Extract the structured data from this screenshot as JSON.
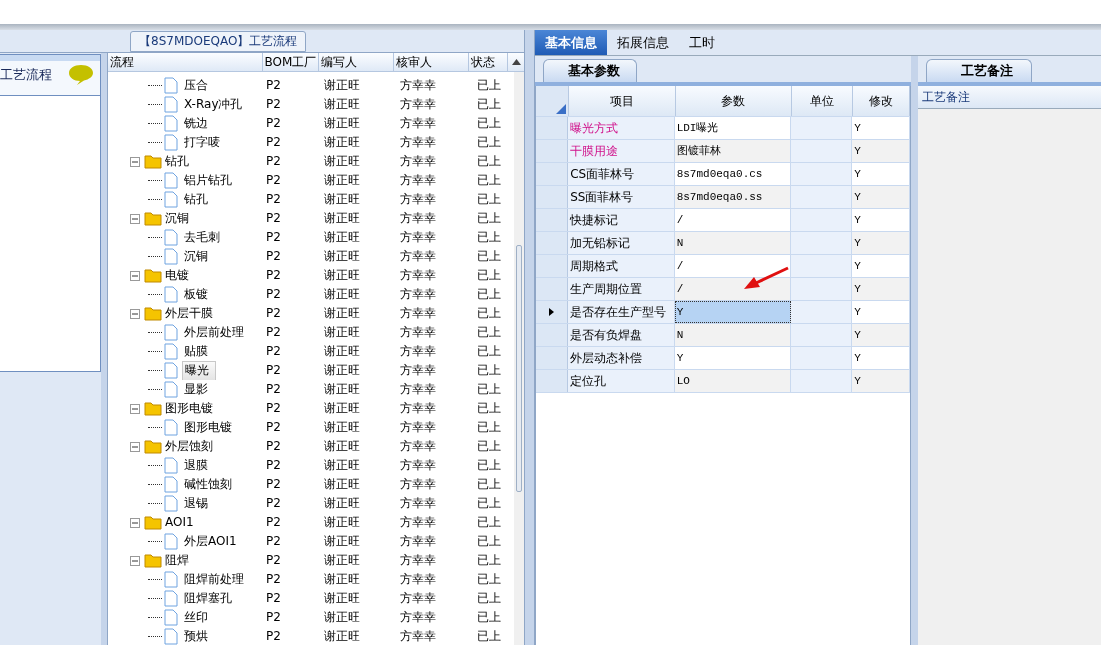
{
  "flow_box": {
    "title": "【8S7MDOEQAO】工艺流程"
  },
  "left_panel": {
    "title": "工艺流程"
  },
  "tree": {
    "columns": [
      "流程",
      "BOM工厂",
      "编写人",
      "核审人",
      "状态"
    ],
    "nodes": [
      {
        "kind": "leaf",
        "label": "压合",
        "bom": "P2",
        "writer": "谢正旺",
        "reviewer": "方幸幸",
        "status": "已上",
        "selected": false
      },
      {
        "kind": "leaf",
        "label": "X-Ray冲孔",
        "bom": "P2",
        "writer": "谢正旺",
        "reviewer": "方幸幸",
        "status": "已上",
        "selected": false
      },
      {
        "kind": "leaf",
        "label": "铣边",
        "bom": "P2",
        "writer": "谢正旺",
        "reviewer": "方幸幸",
        "status": "已上",
        "selected": false
      },
      {
        "kind": "leaf",
        "label": "打字唛",
        "bom": "P2",
        "writer": "谢正旺",
        "reviewer": "方幸幸",
        "status": "已上",
        "selected": false
      },
      {
        "kind": "folder",
        "label": "钻孔",
        "bom": "P2",
        "writer": "谢正旺",
        "reviewer": "方幸幸",
        "status": "已上",
        "selected": false,
        "expanded": true,
        "children": [
          {
            "kind": "leaf",
            "label": "铝片钻孔",
            "bom": "P2",
            "writer": "谢正旺",
            "reviewer": "方幸幸",
            "status": "已上",
            "selected": false
          },
          {
            "kind": "leaf",
            "label": "钻孔",
            "bom": "P2",
            "writer": "谢正旺",
            "reviewer": "方幸幸",
            "status": "已上",
            "selected": false
          }
        ]
      },
      {
        "kind": "folder",
        "label": "沉铜",
        "bom": "P2",
        "writer": "谢正旺",
        "reviewer": "方幸幸",
        "status": "已上",
        "selected": false,
        "expanded": true,
        "children": [
          {
            "kind": "leaf",
            "label": "去毛刺",
            "bom": "P2",
            "writer": "谢正旺",
            "reviewer": "方幸幸",
            "status": "已上",
            "selected": false
          },
          {
            "kind": "leaf",
            "label": "沉铜",
            "bom": "P2",
            "writer": "谢正旺",
            "reviewer": "方幸幸",
            "status": "已上",
            "selected": false
          }
        ]
      },
      {
        "kind": "folder",
        "label": "电镀",
        "bom": "P2",
        "writer": "谢正旺",
        "reviewer": "方幸幸",
        "status": "已上",
        "selected": false,
        "expanded": true,
        "children": [
          {
            "kind": "leaf",
            "label": "板镀",
            "bom": "P2",
            "writer": "谢正旺",
            "reviewer": "方幸幸",
            "status": "已上",
            "selected": false
          }
        ]
      },
      {
        "kind": "folder",
        "label": "外层干膜",
        "bom": "P2",
        "writer": "谢正旺",
        "reviewer": "方幸幸",
        "status": "已上",
        "selected": false,
        "expanded": true,
        "children": [
          {
            "kind": "leaf",
            "label": "外层前处理",
            "bom": "P2",
            "writer": "谢正旺",
            "reviewer": "方幸幸",
            "status": "已上",
            "selected": false
          },
          {
            "kind": "leaf",
            "label": "贴膜",
            "bom": "P2",
            "writer": "谢正旺",
            "reviewer": "方幸幸",
            "status": "已上",
            "selected": false
          },
          {
            "kind": "leaf",
            "label": "曝光",
            "bom": "P2",
            "writer": "谢正旺",
            "reviewer": "方幸幸",
            "status": "已上",
            "selected": true
          },
          {
            "kind": "leaf",
            "label": "显影",
            "bom": "P2",
            "writer": "谢正旺",
            "reviewer": "方幸幸",
            "status": "已上",
            "selected": false
          }
        ]
      },
      {
        "kind": "folder",
        "label": "图形电镀",
        "bom": "P2",
        "writer": "谢正旺",
        "reviewer": "方幸幸",
        "status": "已上",
        "selected": false,
        "expanded": true,
        "children": [
          {
            "kind": "leaf",
            "label": "图形电镀",
            "bom": "P2",
            "writer": "谢正旺",
            "reviewer": "方幸幸",
            "status": "已上",
            "selected": false
          }
        ]
      },
      {
        "kind": "folder",
        "label": "外层蚀刻",
        "bom": "P2",
        "writer": "谢正旺",
        "reviewer": "方幸幸",
        "status": "已上",
        "selected": false,
        "expanded": true,
        "children": [
          {
            "kind": "leaf",
            "label": "退膜",
            "bom": "P2",
            "writer": "谢正旺",
            "reviewer": "方幸幸",
            "status": "已上",
            "selected": false
          },
          {
            "kind": "leaf",
            "label": "碱性蚀刻",
            "bom": "P2",
            "writer": "谢正旺",
            "reviewer": "方幸幸",
            "status": "已上",
            "selected": false
          },
          {
            "kind": "leaf",
            "label": "退锡",
            "bom": "P2",
            "writer": "谢正旺",
            "reviewer": "方幸幸",
            "status": "已上",
            "selected": false
          }
        ]
      },
      {
        "kind": "folder",
        "label": "AOI1",
        "bom": "P2",
        "writer": "谢正旺",
        "reviewer": "方幸幸",
        "status": "已上",
        "selected": false,
        "expanded": true,
        "children": [
          {
            "kind": "leaf",
            "label": "外层AOI1",
            "bom": "P2",
            "writer": "谢正旺",
            "reviewer": "方幸幸",
            "status": "已上",
            "selected": false
          }
        ]
      },
      {
        "kind": "folder",
        "label": "阻焊",
        "bom": "P2",
        "writer": "谢正旺",
        "reviewer": "方幸幸",
        "status": "已上",
        "selected": false,
        "expanded": true,
        "children": [
          {
            "kind": "leaf",
            "label": "阻焊前处理",
            "bom": "P2",
            "writer": "谢正旺",
            "reviewer": "方幸幸",
            "status": "已上",
            "selected": false
          },
          {
            "kind": "leaf",
            "label": "阻焊塞孔",
            "bom": "P2",
            "writer": "谢正旺",
            "reviewer": "方幸幸",
            "status": "已上",
            "selected": false
          },
          {
            "kind": "leaf",
            "label": "丝印",
            "bom": "P2",
            "writer": "谢正旺",
            "reviewer": "方幸幸",
            "status": "已上",
            "selected": false
          },
          {
            "kind": "leaf",
            "label": "预烘",
            "bom": "P2",
            "writer": "谢正旺",
            "reviewer": "方幸幸",
            "status": "已上",
            "selected": false
          }
        ]
      }
    ]
  },
  "tabs": [
    {
      "label": "基本信息",
      "selected": true
    },
    {
      "label": "拓展信息",
      "selected": false
    },
    {
      "label": "工时",
      "selected": false
    }
  ],
  "params": {
    "tab": "基本参数",
    "columns": [
      "项目",
      "参数",
      "单位",
      "修改"
    ],
    "rows": [
      {
        "item": "曝光方式",
        "value": "LDI曝光",
        "modify": "Y",
        "highlighted": true,
        "selected": false
      },
      {
        "item": "干膜用途",
        "value": "图镀菲林",
        "modify": "Y",
        "highlighted": true,
        "selected": false
      },
      {
        "item": "CS面菲林号",
        "value": "8s7md0eqa0.cs",
        "modify": "Y",
        "highlighted": false,
        "selected": false
      },
      {
        "item": "SS面菲林号",
        "value": "8s7md0eqa0.ss",
        "modify": "Y",
        "highlighted": false,
        "selected": false
      },
      {
        "item": "快捷标记",
        "value": "/",
        "modify": "Y",
        "highlighted": false,
        "selected": false
      },
      {
        "item": "加无铅标记",
        "value": "N",
        "modify": "Y",
        "highlighted": false,
        "selected": false
      },
      {
        "item": "周期格式",
        "value": "/",
        "modify": "Y",
        "highlighted": false,
        "selected": false
      },
      {
        "item": "生产周期位置",
        "value": "/",
        "modify": "Y",
        "highlighted": false,
        "selected": false
      },
      {
        "item": "是否存在生产型号",
        "value": "Y",
        "modify": "Y",
        "highlighted": false,
        "selected": true
      },
      {
        "item": "是否有负焊盘",
        "value": "N",
        "modify": "Y",
        "highlighted": false,
        "selected": false
      },
      {
        "item": "外层动态补偿",
        "value": "Y",
        "modify": "Y",
        "highlighted": false,
        "selected": false
      },
      {
        "item": "定位孔",
        "value": "LO",
        "modify": "Y",
        "highlighted": false,
        "selected": false
      }
    ]
  },
  "notes": {
    "tab": "工艺备注",
    "header": "工艺备注"
  }
}
